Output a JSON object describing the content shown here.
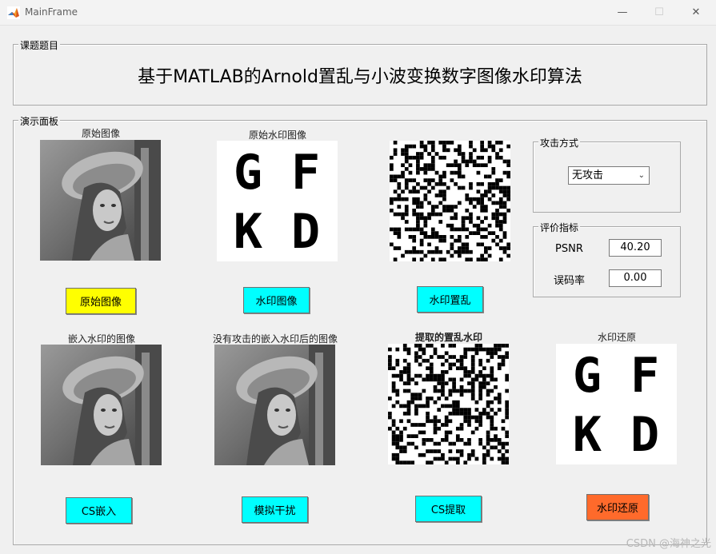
{
  "window": {
    "title": "MainFrame",
    "minimize": "—",
    "maximize": "☐",
    "close": "✕"
  },
  "topic_group": {
    "legend": "课题题目",
    "title": "基于MATLAB的Arnold置乱与小波变换数字图像水印算法"
  },
  "demo_group": {
    "legend": "演示面板"
  },
  "captions": {
    "original_image": "原始图像",
    "original_watermark": "原始水印图像",
    "embedded_image": "嵌入水印的图像",
    "no_attack_embedded": "没有攻击的嵌入水印后的图像",
    "extracted_scrambled": "提取的置乱水印",
    "watermark_restored": "水印还原"
  },
  "watermark_letters": {
    "row1": "G F",
    "row2": "K D"
  },
  "buttons": {
    "original_image": "原始图像",
    "watermark_image": "水印图像",
    "watermark_scramble": "水印置乱",
    "cs_embed": "CS嵌入",
    "simulate_interference": "模拟干扰",
    "cs_extract": "CS提取",
    "watermark_restore": "水印还原"
  },
  "button_colors": {
    "yellow": "#ffff00",
    "cyan": "#00ffff",
    "orange": "#ff6a2b"
  },
  "attack_group": {
    "legend": "攻击方式",
    "selected": "无攻击"
  },
  "metrics_group": {
    "legend": "评价指标",
    "psnr_label": "PSNR",
    "psnr_value": "40.20",
    "ber_label": "误码率",
    "ber_value": "0.00"
  },
  "watermark_credit": "CSDN @海神之光"
}
